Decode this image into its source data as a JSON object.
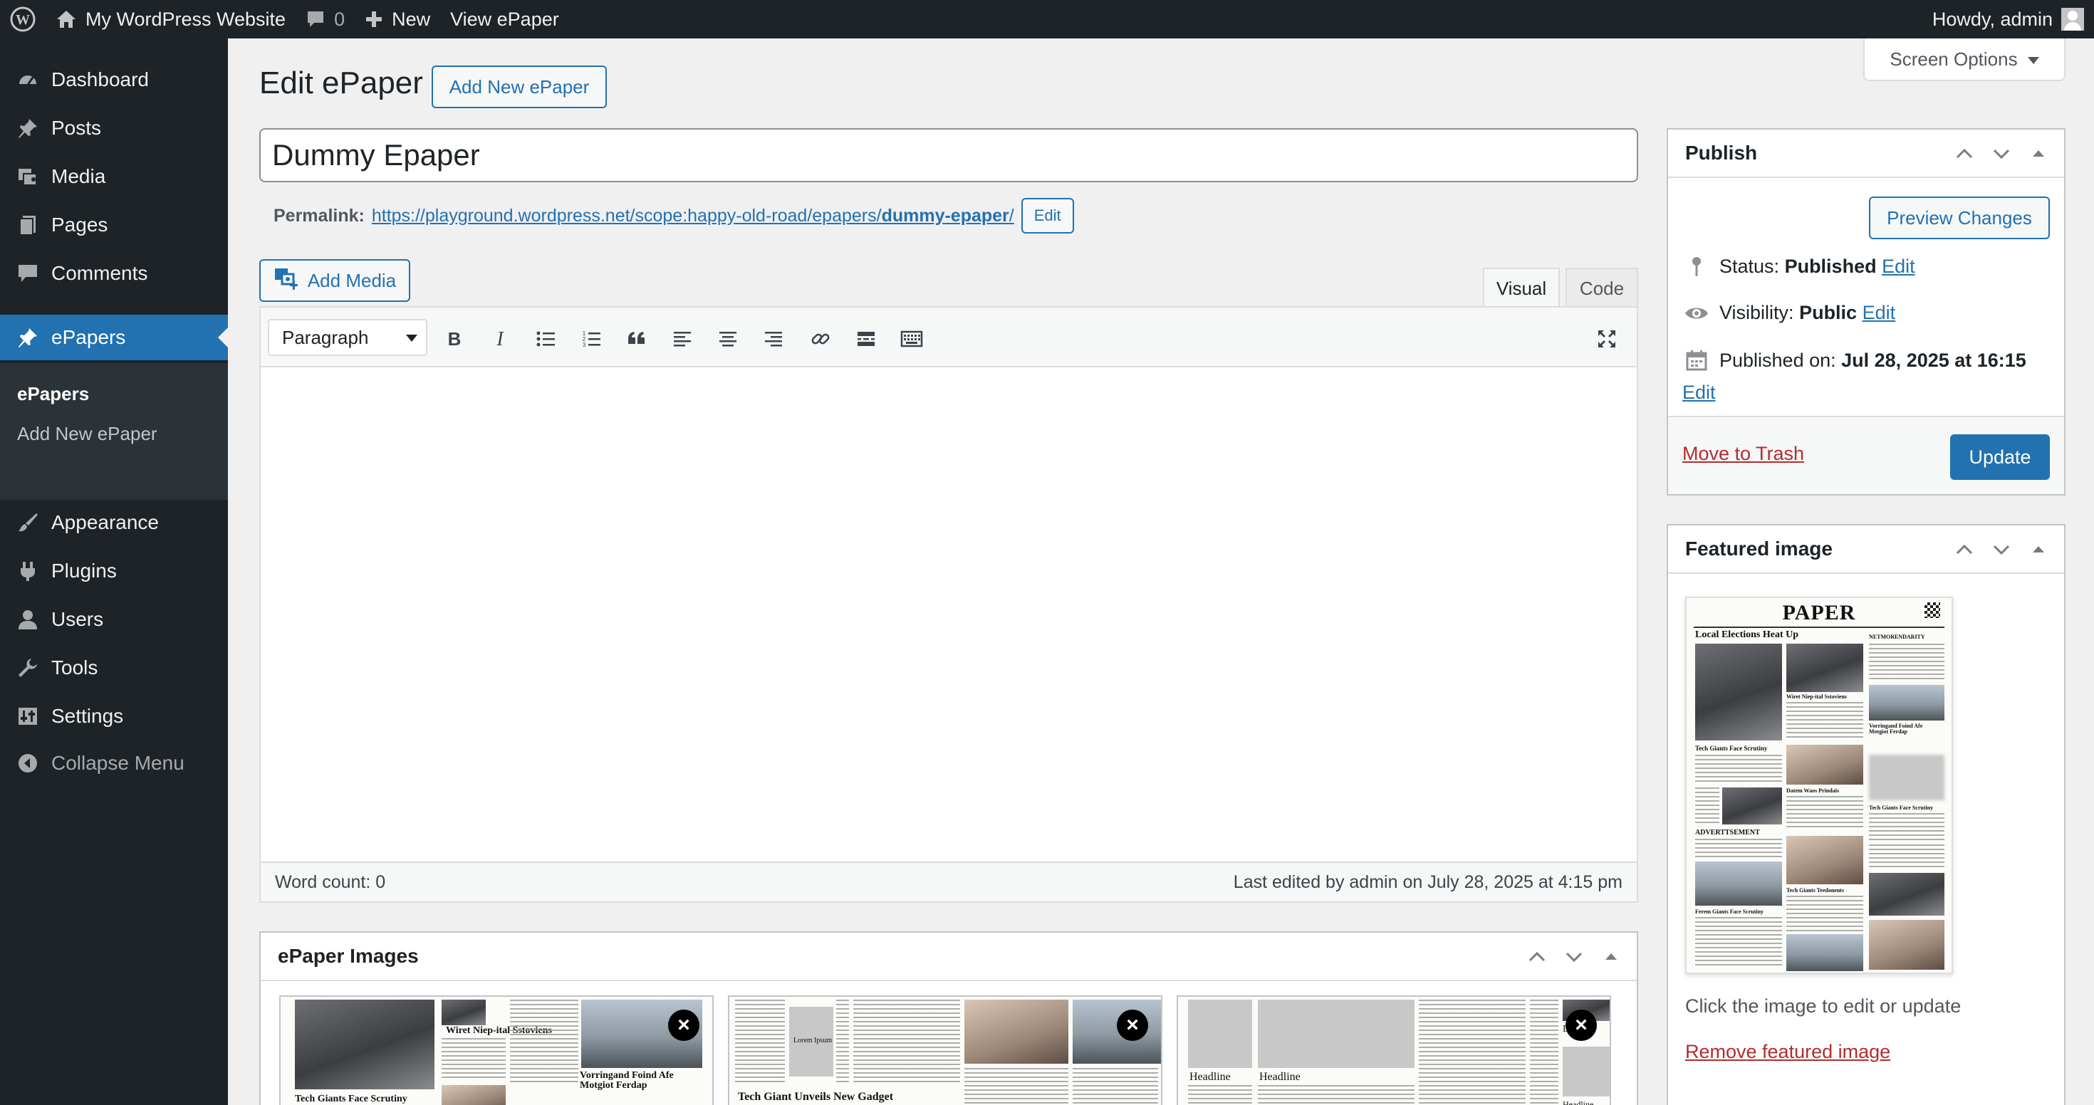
{
  "adminbar": {
    "site_name": "My WordPress Website",
    "comments_count": "0",
    "new_label": "New",
    "view_label": "View ePaper",
    "howdy": "Howdy, admin"
  },
  "sidebar": {
    "items": [
      {
        "label": "Dashboard",
        "icon": "dashboard-icon"
      },
      {
        "label": "Posts",
        "icon": "pin-icon"
      },
      {
        "label": "Media",
        "icon": "media-icon"
      },
      {
        "label": "Pages",
        "icon": "pages-icon"
      },
      {
        "label": "Comments",
        "icon": "comment-icon"
      },
      {
        "label": "ePapers",
        "icon": "pin-icon"
      },
      {
        "label": "Appearance",
        "icon": "brush-icon"
      },
      {
        "label": "Plugins",
        "icon": "plugin-icon"
      },
      {
        "label": "Users",
        "icon": "user-icon"
      },
      {
        "label": "Tools",
        "icon": "wrench-icon"
      },
      {
        "label": "Settings",
        "icon": "settings-icon"
      }
    ],
    "submenu": [
      "ePapers",
      "Add New ePaper"
    ],
    "collapse": "Collapse Menu"
  },
  "header": {
    "title": "Edit ePaper",
    "add_new": "Add New ePaper",
    "screen_options": "Screen Options"
  },
  "post": {
    "title": "Dummy Epaper",
    "permalink_label": "Permalink:",
    "permalink_base": "https://playground.wordpress.net/scope:happy-old-road/epapers/",
    "permalink_slug": "dummy-epaper",
    "permalink_trailing": "/",
    "permalink_edit": "Edit"
  },
  "editor": {
    "add_media": "Add Media",
    "tab_visual": "Visual",
    "tab_code": "Code",
    "format": "Paragraph",
    "word_count": "Word count: 0",
    "last_edited": "Last edited by admin on July 28, 2025 at 4:15 pm"
  },
  "publish": {
    "title": "Publish",
    "preview": "Preview Changes",
    "status_label": "Status:",
    "status_value": "Published",
    "visibility_label": "Visibility:",
    "visibility_value": "Public",
    "published_label": "Published on:",
    "published_value": "Jul 28, 2025 at 16:15",
    "edit": "Edit",
    "trash": "Move to Trash",
    "update": "Update"
  },
  "featured": {
    "title": "Featured image",
    "masthead": "PAPER",
    "headlines": [
      "Local Elections Heat Up",
      "NETMORENDARITY",
      "Wiret Niep-ital Sstoviens",
      "Vorringand Foind Afe Motgiot Ferdap",
      "Tech Giants Face Scrutiny",
      "Datem Waos Prindais",
      "Tech Giants Face Scrutiny",
      "ADVERTTSEMENT",
      "Tech Giants Teedonents",
      "Ferem Giants Face Scrutiny"
    ],
    "hint": "Click the image to edit or update",
    "remove": "Remove featured image"
  },
  "epaper_images": {
    "title": "ePaper Images",
    "thumbs": [
      {
        "headlines": [
          "Wiret Niep-ital Sstoviens",
          "Vorringand Foind Afe Motgiot Ferdap",
          "Tech Giants Face Scrutiny"
        ]
      },
      {
        "headlines": [
          "Lorem Ipsum",
          "Tech Giant Unveils New Gadget"
        ]
      },
      {
        "headlines": [
          "Headline",
          "Headline",
          "Headline",
          "Dumm"
        ]
      }
    ]
  },
  "colors": {
    "admin_dark": "#1d2327",
    "accent": "#2271b1",
    "danger": "#b32d2e",
    "background": "#f0f0f1"
  }
}
